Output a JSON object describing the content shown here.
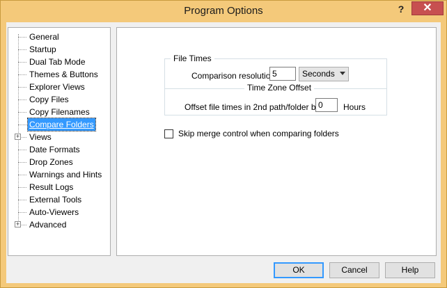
{
  "window": {
    "title": "Program Options",
    "help_label": "?",
    "close_label": "✕"
  },
  "tree": {
    "items": [
      {
        "label": "General",
        "expander": ""
      },
      {
        "label": "Startup",
        "expander": ""
      },
      {
        "label": "Dual Tab Mode",
        "expander": ""
      },
      {
        "label": "Themes & Buttons",
        "expander": ""
      },
      {
        "label": "Explorer Views",
        "expander": ""
      },
      {
        "label": "Copy Files",
        "expander": ""
      },
      {
        "label": "Copy Filenames",
        "expander": ""
      },
      {
        "label": "Compare Folders",
        "expander": "",
        "selected": true
      },
      {
        "label": "Views",
        "expander": "+"
      },
      {
        "label": "Date Formats",
        "expander": ""
      },
      {
        "label": "Drop Zones",
        "expander": ""
      },
      {
        "label": "Warnings and Hints",
        "expander": ""
      },
      {
        "label": "Result Logs",
        "expander": ""
      },
      {
        "label": "External Tools",
        "expander": ""
      },
      {
        "label": "Auto-Viewers",
        "expander": ""
      },
      {
        "label": "Advanced",
        "expander": "+"
      }
    ]
  },
  "file_times": {
    "group_title": "File Times",
    "comparison_label": "Comparison resolution",
    "comparison_value": "5",
    "unit_selected": "Seconds",
    "tz_title": "Time Zone Offset",
    "offset_label": "Offset file times in 2nd path/folder by",
    "offset_value": "0",
    "hours_label": "Hours"
  },
  "skip_merge": {
    "label": "Skip merge control when comparing folders",
    "checked": false
  },
  "buttons": {
    "ok": "OK",
    "cancel": "Cancel",
    "help": "Help"
  }
}
